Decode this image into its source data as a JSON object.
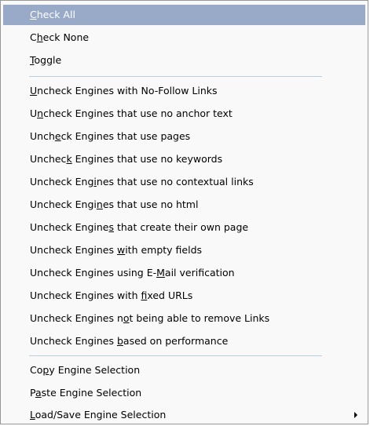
{
  "menu": {
    "items": [
      {
        "pre": "",
        "key": "C",
        "post": "heck All"
      },
      {
        "pre": "C",
        "key": "h",
        "post": "eck None"
      },
      {
        "pre": "",
        "key": "T",
        "post": "oggle"
      },
      {
        "pre": "",
        "key": "U",
        "post": "ncheck Engines with No-Follow Links"
      },
      {
        "pre": "U",
        "key": "n",
        "post": "check Engines that use no anchor text"
      },
      {
        "pre": "Unch",
        "key": "e",
        "post": "ck Engines that use pages"
      },
      {
        "pre": "Unchec",
        "key": "k",
        "post": " Engines that use no keywords"
      },
      {
        "pre": "Uncheck Eng",
        "key": "i",
        "post": "nes that use no contextual links"
      },
      {
        "pre": "Uncheck Engi",
        "key": "n",
        "post": "es that use no html"
      },
      {
        "pre": "Uncheck Engine",
        "key": "s",
        "post": " that create their own page"
      },
      {
        "pre": "Uncheck Engines ",
        "key": "w",
        "post": "ith empty fields"
      },
      {
        "pre": "Uncheck Engines using E-",
        "key": "M",
        "post": "ail verification"
      },
      {
        "pre": "Uncheck Engines with ",
        "key": "f",
        "post": "ixed URLs"
      },
      {
        "pre": "Uncheck Engines n",
        "key": "o",
        "post": "t being able to remove Links"
      },
      {
        "pre": "Uncheck Engines ",
        "key": "b",
        "post": "ased on performance"
      },
      {
        "pre": "Co",
        "key": "p",
        "post": "y Engine Selection"
      },
      {
        "pre": "P",
        "key": "a",
        "post": "ste Engine Selection"
      },
      {
        "pre": "",
        "key": "L",
        "post": "oad/Save Engine Selection"
      }
    ]
  }
}
